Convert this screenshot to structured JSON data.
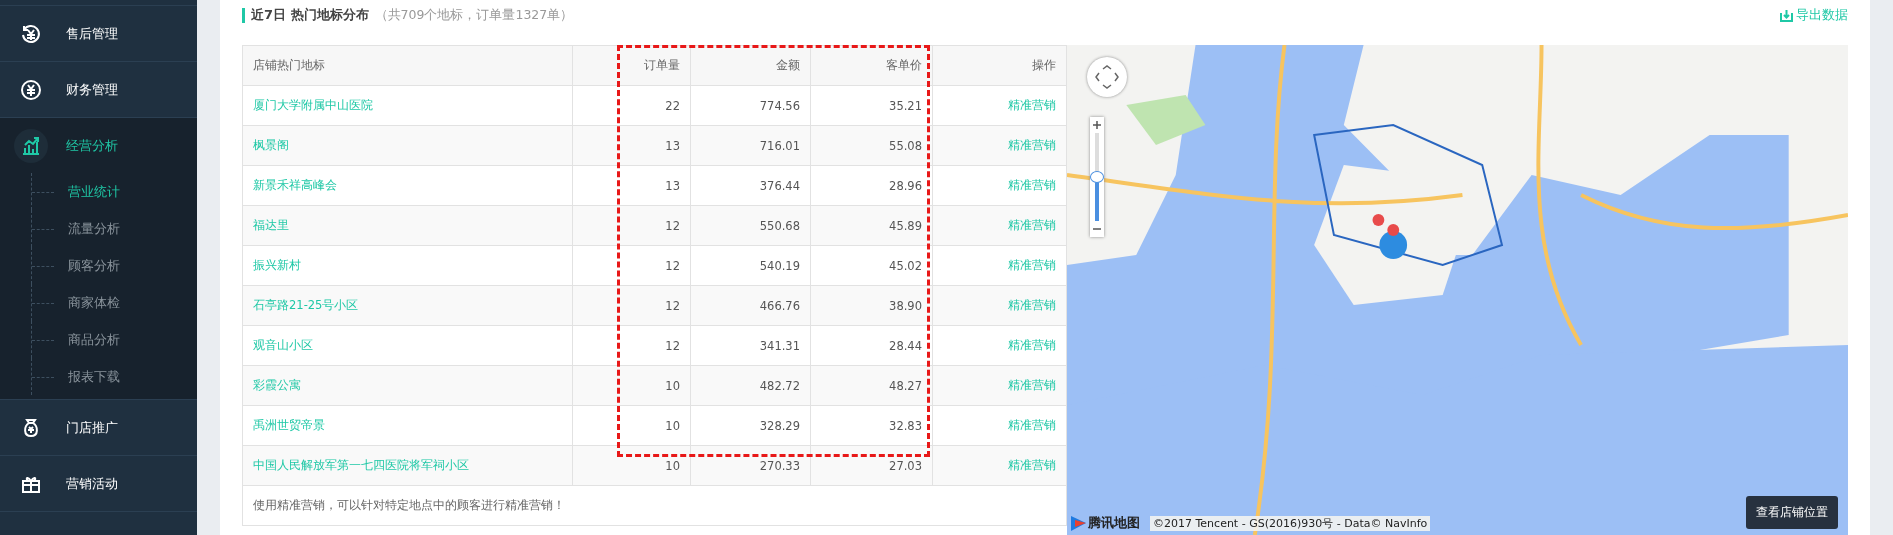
{
  "sidebar": {
    "items": [
      {
        "label": "售后管理",
        "selected": false,
        "expanded": false
      },
      {
        "label": "财务管理",
        "selected": false,
        "expanded": false
      },
      {
        "label": "经营分析",
        "selected": true,
        "expanded": true,
        "children": [
          {
            "label": "营业统计",
            "selected": true
          },
          {
            "label": "流量分析",
            "selected": false
          },
          {
            "label": "顾客分析",
            "selected": false
          },
          {
            "label": "商家体检",
            "selected": false
          },
          {
            "label": "商品分析",
            "selected": false
          },
          {
            "label": "报表下载",
            "selected": false
          }
        ]
      },
      {
        "label": "门店推广",
        "selected": false,
        "expanded": false
      },
      {
        "label": "营销活动",
        "selected": false,
        "expanded": false
      }
    ]
  },
  "section": {
    "title": "近7日 热门地标分布",
    "subtitle": "（共709个地标，订单量1327单）",
    "export": "导出数据"
  },
  "table": {
    "columns": [
      "店铺热门地标",
      "订单量",
      "金额",
      "客单价",
      "操作"
    ],
    "rows": [
      {
        "name": "厦门大学附属中山医院",
        "orders": "22",
        "amount": "774.56",
        "avg": "35.21",
        "action": "精准营销"
      },
      {
        "name": "枫景阁",
        "orders": "13",
        "amount": "716.01",
        "avg": "55.08",
        "action": "精准营销"
      },
      {
        "name": "新景禾祥高峰会",
        "orders": "13",
        "amount": "376.44",
        "avg": "28.96",
        "action": "精准营销"
      },
      {
        "name": "福达里",
        "orders": "12",
        "amount": "550.68",
        "avg": "45.89",
        "action": "精准营销"
      },
      {
        "name": "振兴新村",
        "orders": "12",
        "amount": "540.19",
        "avg": "45.02",
        "action": "精准营销"
      },
      {
        "name": "石亭路21-25号小区",
        "orders": "12",
        "amount": "466.76",
        "avg": "38.90",
        "action": "精准营销"
      },
      {
        "name": "观音山小区",
        "orders": "12",
        "amount": "341.31",
        "avg": "28.44",
        "action": "精准营销"
      },
      {
        "name": "彩霞公寓",
        "orders": "10",
        "amount": "482.72",
        "avg": "48.27",
        "action": "精准营销"
      },
      {
        "name": "禹洲世贸帝景",
        "orders": "10",
        "amount": "328.29",
        "avg": "32.83",
        "action": "精准营销"
      },
      {
        "name": "中国人民解放军第一七四医院将军祠小区",
        "orders": "10",
        "amount": "270.33",
        "avg": "27.03",
        "action": "精准营销"
      }
    ],
    "footer": "使用精准营销，可以针对特定地点中的顾客进行精准营销！"
  },
  "map": {
    "zoom": {
      "level": 0.5
    },
    "logo": "腾讯地图",
    "copyright": "©2017 Tencent - GS(2016)930号 - Data© NavInfo",
    "button": "查看店铺位置"
  }
}
